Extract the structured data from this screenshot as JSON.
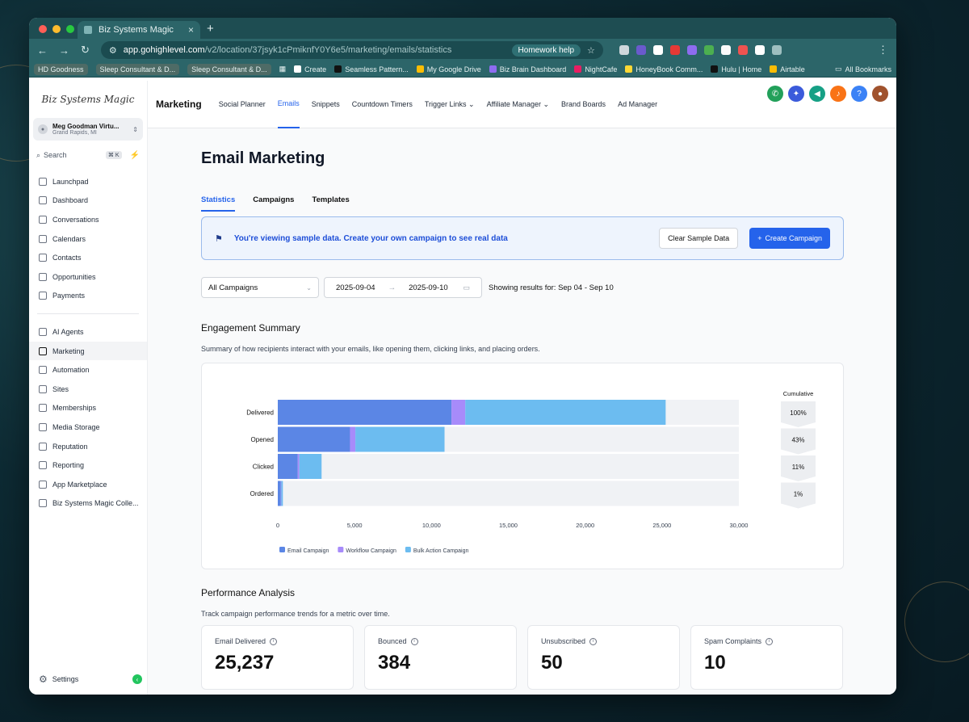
{
  "browser": {
    "tab_title": "Biz Systems Magic",
    "url_host": "app.gohighlevel.com",
    "url_path": "/v2/location/37jsyk1cPmiknfY0Y6e5/marketing/emails/statistics",
    "homework_chip": "Homework help",
    "bookmarks": [
      "HD Goodness",
      "Sleep Consultant & D...",
      "Sleep Consultant & D...",
      "Create",
      "Seamless Pattern...",
      "My Google Drive",
      "Biz Brain Dashboard",
      "NightCafe",
      "HoneyBook Comm...",
      "Hulu | Home",
      "Airtable"
    ],
    "all_bookmarks": "All Bookmarks"
  },
  "sidebar": {
    "logo": "Biz Systems Magic",
    "account_name": "Meg Goodman Virtu...",
    "account_location": "Grand Rapids, MI",
    "search_label": "Search",
    "search_kbd": "⌘ K",
    "items_top": [
      "Launchpad",
      "Dashboard",
      "Conversations",
      "Calendars",
      "Contacts",
      "Opportunities",
      "Payments"
    ],
    "items_bottom": [
      "AI Agents",
      "Marketing",
      "Automation",
      "Sites",
      "Memberships",
      "Media Storage",
      "Reputation",
      "Reporting",
      "App Marketplace",
      "Biz Systems Magic Colle..."
    ],
    "settings": "Settings"
  },
  "topnav": {
    "title": "Marketing",
    "items": [
      "Social Planner",
      "Emails",
      "Snippets",
      "Countdown Timers",
      "Trigger Links",
      "Affiliate Manager",
      "Brand Boards",
      "Ad Manager"
    ]
  },
  "page": {
    "title": "Email Marketing",
    "tabs": [
      "Statistics",
      "Campaigns",
      "Templates"
    ],
    "banner_text": "You're viewing sample data. Create your own campaign to see real data",
    "clear_button": "Clear Sample Data",
    "create_button": "Create Campaign",
    "campaign_select": "All Campaigns",
    "date_start": "2025-09-04",
    "date_end": "2025-09-10",
    "showing": "Showing results for: Sep 04 - Sep 10",
    "engagement_title": "Engagement Summary",
    "engagement_sub": "Summary of how recipients interact with your emails, like opening them, clicking links, and placing orders.",
    "performance_title": "Performance Analysis",
    "performance_sub": "Track campaign performance trends for a metric over time."
  },
  "metrics": [
    {
      "label": "Email Delivered",
      "value": "25,237"
    },
    {
      "label": "Bounced",
      "value": "384"
    },
    {
      "label": "Unsubscribed",
      "value": "50"
    },
    {
      "label": "Spam Complaints",
      "value": "10"
    }
  ],
  "colors": {
    "email": "#5b86e5",
    "workflow": "#a78bfa",
    "bulk": "#6cbcf0",
    "track": "#f0f2f5",
    "accent": "#2563eb"
  },
  "chart_data": {
    "type": "bar",
    "orientation": "horizontal",
    "stacked": true,
    "categories": [
      "Delivered",
      "Opened",
      "Clicked",
      "Ordered"
    ],
    "series": [
      {
        "name": "Email Campaign",
        "values": [
          11300,
          4700,
          1300,
          200
        ]
      },
      {
        "name": "Workflow Campaign",
        "values": [
          900,
          350,
          100,
          30
        ]
      },
      {
        "name": "Bulk Action Campaign",
        "values": [
          13037,
          5800,
          1450,
          100
        ]
      }
    ],
    "xlim": [
      0,
      30000
    ],
    "xticks": [
      "0",
      "5,000",
      "10,000",
      "15,000",
      "20,000",
      "25,000",
      "30,000"
    ],
    "cumulative_label": "Cumulative",
    "cumulative": [
      "100%",
      "43%",
      "11%",
      "1%"
    ],
    "legend_position": "bottom-left"
  }
}
